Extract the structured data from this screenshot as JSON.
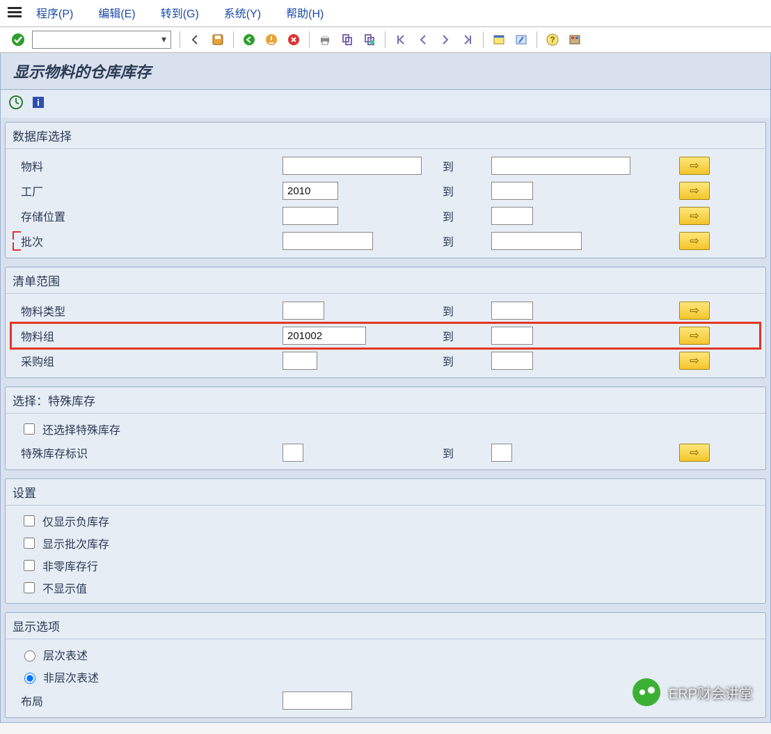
{
  "menu": {
    "items": [
      {
        "label": "程序(P)"
      },
      {
        "label": "编辑(E)"
      },
      {
        "label": "转到(G)"
      },
      {
        "label": "系统(Y)"
      },
      {
        "label": "帮助(H)"
      }
    ]
  },
  "toolbar": {
    "command_value": ""
  },
  "title": "显示物料的仓库库存",
  "groups": {
    "db_select": {
      "title": "数据库选择",
      "rows": {
        "material": {
          "label": "物料",
          "from": "",
          "to_label": "到",
          "to": ""
        },
        "plant": {
          "label": "工厂",
          "from": "2010",
          "to_label": "到",
          "to": ""
        },
        "storage": {
          "label": "存储位置",
          "from": "",
          "to_label": "到",
          "to": ""
        },
        "batch": {
          "label": "批次",
          "from": "",
          "to_label": "到",
          "to": ""
        }
      }
    },
    "list_scope": {
      "title": "清单范围",
      "rows": {
        "mat_type": {
          "label": "物料类型",
          "from": "",
          "to_label": "到",
          "to": ""
        },
        "mat_group": {
          "label": "物料组",
          "from": "201002",
          "to_label": "到",
          "to": ""
        },
        "pur_group": {
          "label": "采购组",
          "from": "",
          "to_label": "到",
          "to": ""
        }
      }
    },
    "special_stock": {
      "title": "选择：特殊库存",
      "also_select_label": "还选择特殊库存",
      "also_select_checked": false,
      "indicator": {
        "label": "特殊库存标识",
        "from": "",
        "to_label": "到",
        "to": ""
      }
    },
    "settings": {
      "title": "设置",
      "checks": [
        {
          "label": "仅显示负库存",
          "checked": false
        },
        {
          "label": "显示批次库存",
          "checked": false
        },
        {
          "label": "非零库存行",
          "checked": false
        },
        {
          "label": "不显示值",
          "checked": false
        }
      ]
    },
    "display_options": {
      "title": "显示选项",
      "radios": [
        {
          "label": "层次表述",
          "checked": false
        },
        {
          "label": "非层次表述",
          "checked": true
        }
      ],
      "layout": {
        "label": "布局",
        "value": ""
      }
    }
  },
  "watermark": "ERP财会讲堂"
}
